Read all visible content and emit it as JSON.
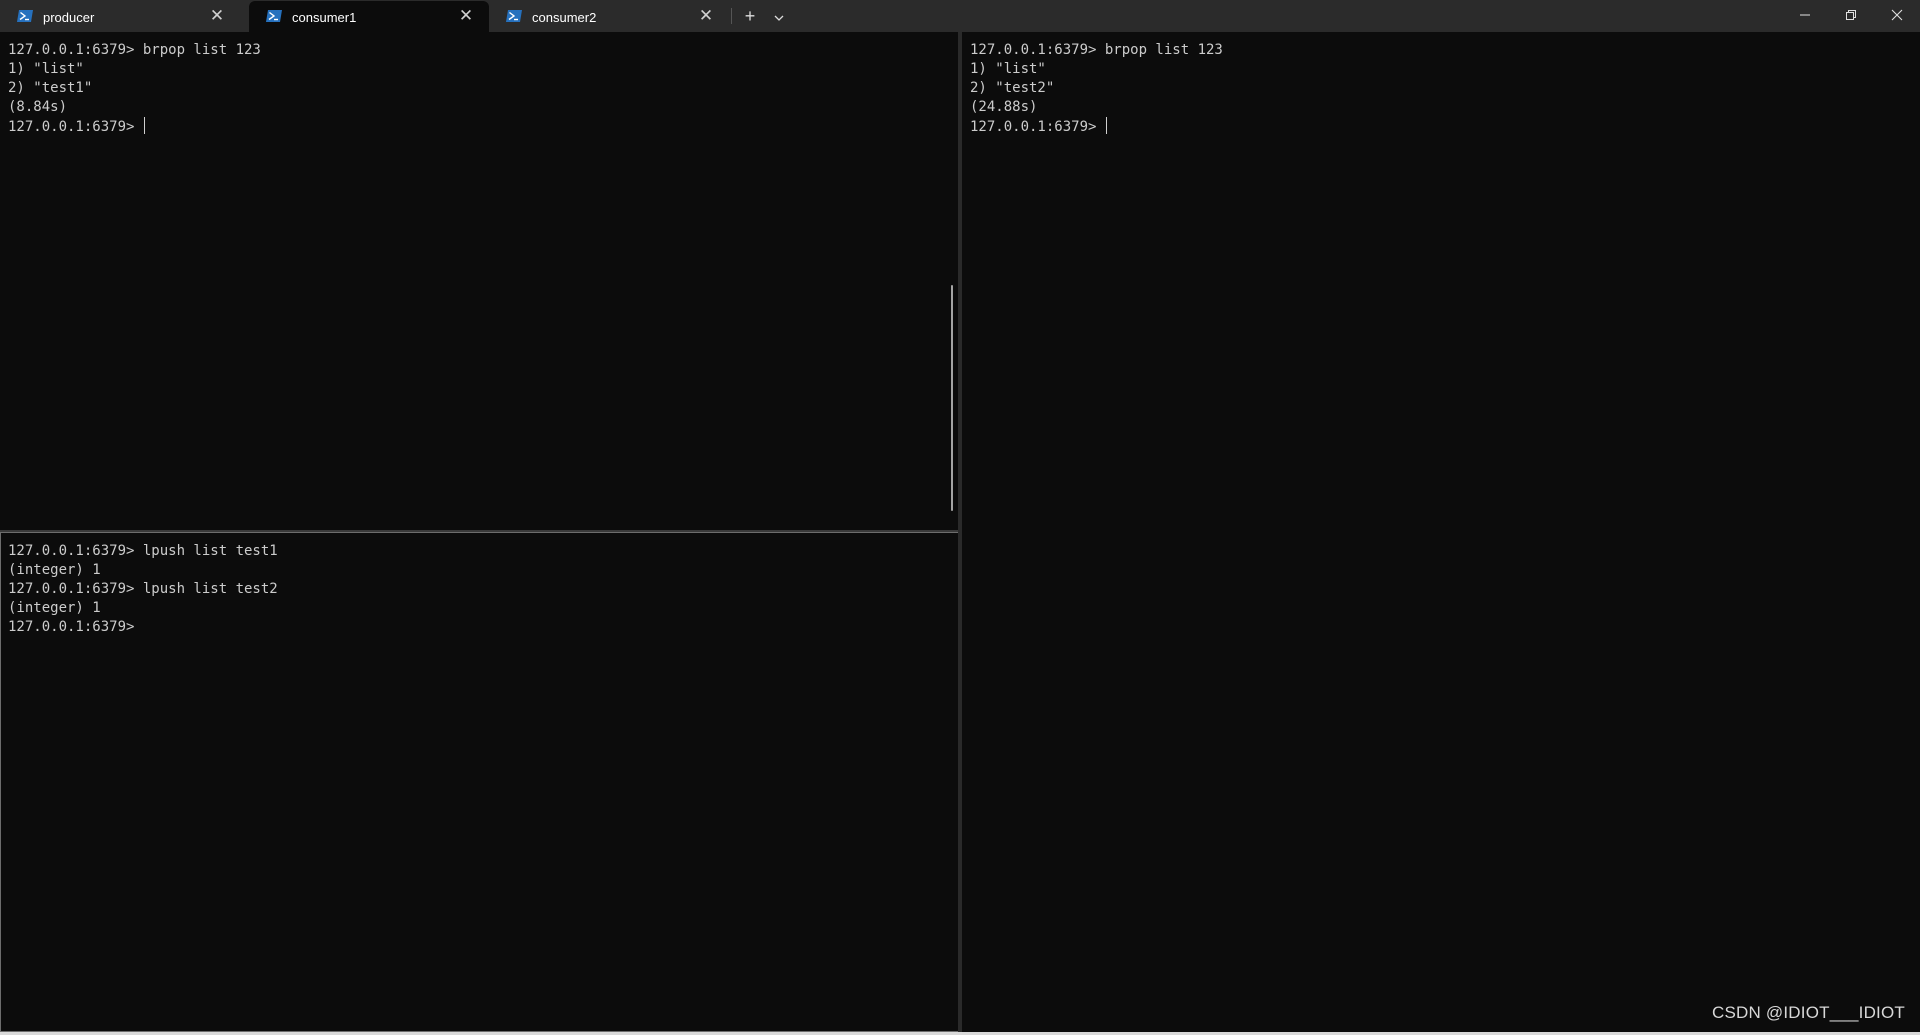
{
  "tabs": [
    {
      "label": "producer",
      "active": false
    },
    {
      "label": "consumer1",
      "active": true
    },
    {
      "label": "consumer2",
      "active": false
    }
  ],
  "controls": {
    "new_tab": "+",
    "close_glyph": "✕"
  },
  "icons": {
    "tab_icon": "powershell-icon",
    "minimize": "minimize-icon",
    "maximize": "restore-icon",
    "close": "close-icon",
    "dropdown": "chevron-down-icon"
  },
  "colors": {
    "background": "#0c0c0c",
    "tabbar": "#2b2b2b",
    "text": "#cccccc",
    "powershell_blue": "#2671be"
  },
  "panes": {
    "top_left": {
      "lines": [
        "127.0.0.1:6379> brpop list 123",
        "1) \"list\"",
        "2) \"test1\"",
        "(8.84s)",
        "127.0.0.1:6379> "
      ]
    },
    "bottom_left": {
      "lines": [
        "127.0.0.1:6379> lpush list test1",
        "(integer) 1",
        "127.0.0.1:6379> lpush list test2",
        "(integer) 1",
        "127.0.0.1:6379>"
      ]
    },
    "right": {
      "lines": [
        "127.0.0.1:6379> brpop list 123",
        "1) \"list\"",
        "2) \"test2\"",
        "(24.88s)",
        "127.0.0.1:6379> "
      ]
    }
  },
  "watermark": "CSDN @IDIOT___IDIOT"
}
